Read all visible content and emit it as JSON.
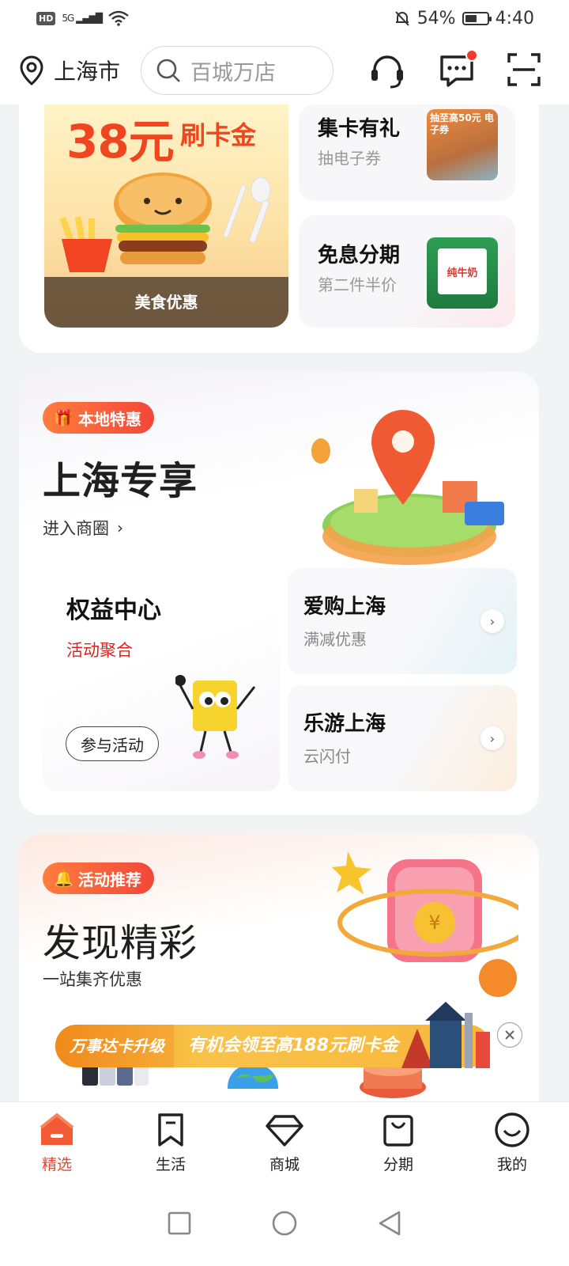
{
  "status": {
    "time": "4:40",
    "battery": "54%",
    "battery_level": 0.54,
    "network": "5G"
  },
  "header": {
    "city": "上海市",
    "search_placeholder": "百城万店"
  },
  "top_promo": {
    "big_amount": "38元",
    "big_tag": "刷卡金",
    "food_label": "美食优惠",
    "collect": {
      "title": "集卡有礼",
      "subtitle": "抽电子券",
      "thumb_text": "抽至高50元 电子券"
    },
    "installment": {
      "title": "免息分期",
      "subtitle": "第二件半价",
      "thumb_text": "纯牛奶"
    }
  },
  "local": {
    "badge": "本地特惠",
    "title": "上海专享",
    "link": "进入商圈",
    "benefit": {
      "title": "权益中心",
      "subtitle": "活动聚合",
      "button": "参与活动"
    },
    "shop": {
      "title": "爱购上海",
      "subtitle": "满减优惠"
    },
    "travel": {
      "title": "乐游上海",
      "subtitle": "云闪付"
    }
  },
  "activity": {
    "badge": "活动推荐",
    "title": "发现精彩",
    "subtitle": "一站集齐优惠"
  },
  "float_banner": {
    "left": "万事达卡升级",
    "right": "有机会领至高188元刷卡金"
  },
  "tabs": [
    {
      "label": "精选",
      "icon": "home-icon",
      "active": true
    },
    {
      "label": "生活",
      "icon": "bookmark-icon",
      "active": false
    },
    {
      "label": "商城",
      "icon": "diamond-icon",
      "active": false
    },
    {
      "label": "分期",
      "icon": "bag-icon",
      "active": false
    },
    {
      "label": "我的",
      "icon": "smile-icon",
      "active": false
    }
  ],
  "colors": {
    "accent": "#e8452f",
    "orange": "#f0461f",
    "badge": "#f2473a"
  }
}
